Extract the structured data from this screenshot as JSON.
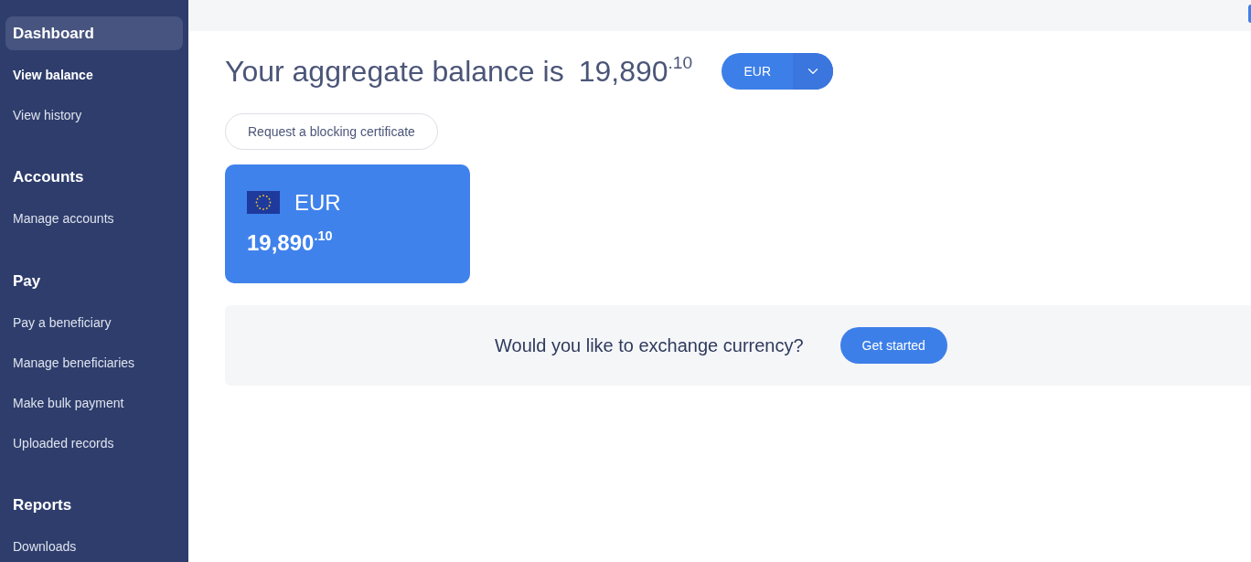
{
  "sidebar": {
    "sections": [
      {
        "title": "Dashboard",
        "selected": true,
        "items": [
          {
            "label": "View balance",
            "selected": true
          },
          {
            "label": "View history",
            "selected": false
          }
        ]
      },
      {
        "title": "Accounts",
        "selected": false,
        "items": [
          {
            "label": "Manage accounts",
            "selected": false
          }
        ]
      },
      {
        "title": "Pay",
        "selected": false,
        "items": [
          {
            "label": "Pay a beneficiary",
            "selected": false
          },
          {
            "label": "Manage beneficiaries",
            "selected": false
          },
          {
            "label": "Make bulk payment",
            "selected": false
          },
          {
            "label": "Uploaded records",
            "selected": false
          }
        ]
      },
      {
        "title": "Reports",
        "selected": false,
        "items": [
          {
            "label": "Downloads",
            "selected": false
          }
        ]
      }
    ]
  },
  "balance": {
    "heading": "Your aggregate balance is",
    "amount": "19,890$^{.10}$",
    "currency_dropdown": {
      "value": "EUR"
    }
  },
  "certificate_button": "Request a blocking certificate",
  "accounts": [
    {
      "currency": "EUR",
      "amount": "19,890$^{.10}$"
    }
  ],
  "exchange_banner": {
    "text": "Would you like to exchange currency?",
    "button": "Get started"
  }
}
